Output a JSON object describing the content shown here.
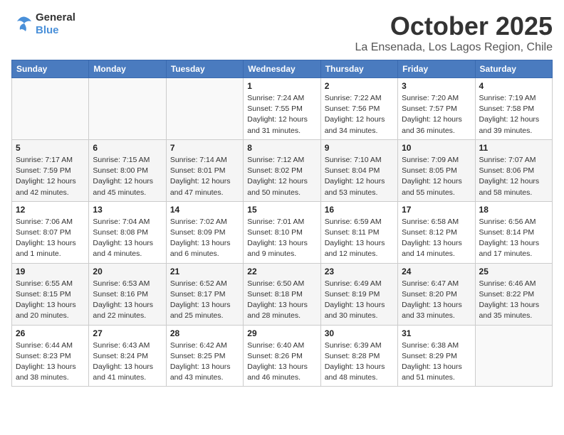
{
  "header": {
    "logo_general": "General",
    "logo_blue": "Blue",
    "month": "October 2025",
    "location": "La Ensenada, Los Lagos Region, Chile"
  },
  "days_of_week": [
    "Sunday",
    "Monday",
    "Tuesday",
    "Wednesday",
    "Thursday",
    "Friday",
    "Saturday"
  ],
  "weeks": [
    [
      {
        "day": "",
        "info": ""
      },
      {
        "day": "",
        "info": ""
      },
      {
        "day": "",
        "info": ""
      },
      {
        "day": "1",
        "info": "Sunrise: 7:24 AM\nSunset: 7:55 PM\nDaylight: 12 hours\nand 31 minutes."
      },
      {
        "day": "2",
        "info": "Sunrise: 7:22 AM\nSunset: 7:56 PM\nDaylight: 12 hours\nand 34 minutes."
      },
      {
        "day": "3",
        "info": "Sunrise: 7:20 AM\nSunset: 7:57 PM\nDaylight: 12 hours\nand 36 minutes."
      },
      {
        "day": "4",
        "info": "Sunrise: 7:19 AM\nSunset: 7:58 PM\nDaylight: 12 hours\nand 39 minutes."
      }
    ],
    [
      {
        "day": "5",
        "info": "Sunrise: 7:17 AM\nSunset: 7:59 PM\nDaylight: 12 hours\nand 42 minutes."
      },
      {
        "day": "6",
        "info": "Sunrise: 7:15 AM\nSunset: 8:00 PM\nDaylight: 12 hours\nand 45 minutes."
      },
      {
        "day": "7",
        "info": "Sunrise: 7:14 AM\nSunset: 8:01 PM\nDaylight: 12 hours\nand 47 minutes."
      },
      {
        "day": "8",
        "info": "Sunrise: 7:12 AM\nSunset: 8:02 PM\nDaylight: 12 hours\nand 50 minutes."
      },
      {
        "day": "9",
        "info": "Sunrise: 7:10 AM\nSunset: 8:04 PM\nDaylight: 12 hours\nand 53 minutes."
      },
      {
        "day": "10",
        "info": "Sunrise: 7:09 AM\nSunset: 8:05 PM\nDaylight: 12 hours\nand 55 minutes."
      },
      {
        "day": "11",
        "info": "Sunrise: 7:07 AM\nSunset: 8:06 PM\nDaylight: 12 hours\nand 58 minutes."
      }
    ],
    [
      {
        "day": "12",
        "info": "Sunrise: 7:06 AM\nSunset: 8:07 PM\nDaylight: 13 hours\nand 1 minute."
      },
      {
        "day": "13",
        "info": "Sunrise: 7:04 AM\nSunset: 8:08 PM\nDaylight: 13 hours\nand 4 minutes."
      },
      {
        "day": "14",
        "info": "Sunrise: 7:02 AM\nSunset: 8:09 PM\nDaylight: 13 hours\nand 6 minutes."
      },
      {
        "day": "15",
        "info": "Sunrise: 7:01 AM\nSunset: 8:10 PM\nDaylight: 13 hours\nand 9 minutes."
      },
      {
        "day": "16",
        "info": "Sunrise: 6:59 AM\nSunset: 8:11 PM\nDaylight: 13 hours\nand 12 minutes."
      },
      {
        "day": "17",
        "info": "Sunrise: 6:58 AM\nSunset: 8:12 PM\nDaylight: 13 hours\nand 14 minutes."
      },
      {
        "day": "18",
        "info": "Sunrise: 6:56 AM\nSunset: 8:14 PM\nDaylight: 13 hours\nand 17 minutes."
      }
    ],
    [
      {
        "day": "19",
        "info": "Sunrise: 6:55 AM\nSunset: 8:15 PM\nDaylight: 13 hours\nand 20 minutes."
      },
      {
        "day": "20",
        "info": "Sunrise: 6:53 AM\nSunset: 8:16 PM\nDaylight: 13 hours\nand 22 minutes."
      },
      {
        "day": "21",
        "info": "Sunrise: 6:52 AM\nSunset: 8:17 PM\nDaylight: 13 hours\nand 25 minutes."
      },
      {
        "day": "22",
        "info": "Sunrise: 6:50 AM\nSunset: 8:18 PM\nDaylight: 13 hours\nand 28 minutes."
      },
      {
        "day": "23",
        "info": "Sunrise: 6:49 AM\nSunset: 8:19 PM\nDaylight: 13 hours\nand 30 minutes."
      },
      {
        "day": "24",
        "info": "Sunrise: 6:47 AM\nSunset: 8:20 PM\nDaylight: 13 hours\nand 33 minutes."
      },
      {
        "day": "25",
        "info": "Sunrise: 6:46 AM\nSunset: 8:22 PM\nDaylight: 13 hours\nand 35 minutes."
      }
    ],
    [
      {
        "day": "26",
        "info": "Sunrise: 6:44 AM\nSunset: 8:23 PM\nDaylight: 13 hours\nand 38 minutes."
      },
      {
        "day": "27",
        "info": "Sunrise: 6:43 AM\nSunset: 8:24 PM\nDaylight: 13 hours\nand 41 minutes."
      },
      {
        "day": "28",
        "info": "Sunrise: 6:42 AM\nSunset: 8:25 PM\nDaylight: 13 hours\nand 43 minutes."
      },
      {
        "day": "29",
        "info": "Sunrise: 6:40 AM\nSunset: 8:26 PM\nDaylight: 13 hours\nand 46 minutes."
      },
      {
        "day": "30",
        "info": "Sunrise: 6:39 AM\nSunset: 8:28 PM\nDaylight: 13 hours\nand 48 minutes."
      },
      {
        "day": "31",
        "info": "Sunrise: 6:38 AM\nSunset: 8:29 PM\nDaylight: 13 hours\nand 51 minutes."
      },
      {
        "day": "",
        "info": ""
      }
    ]
  ]
}
